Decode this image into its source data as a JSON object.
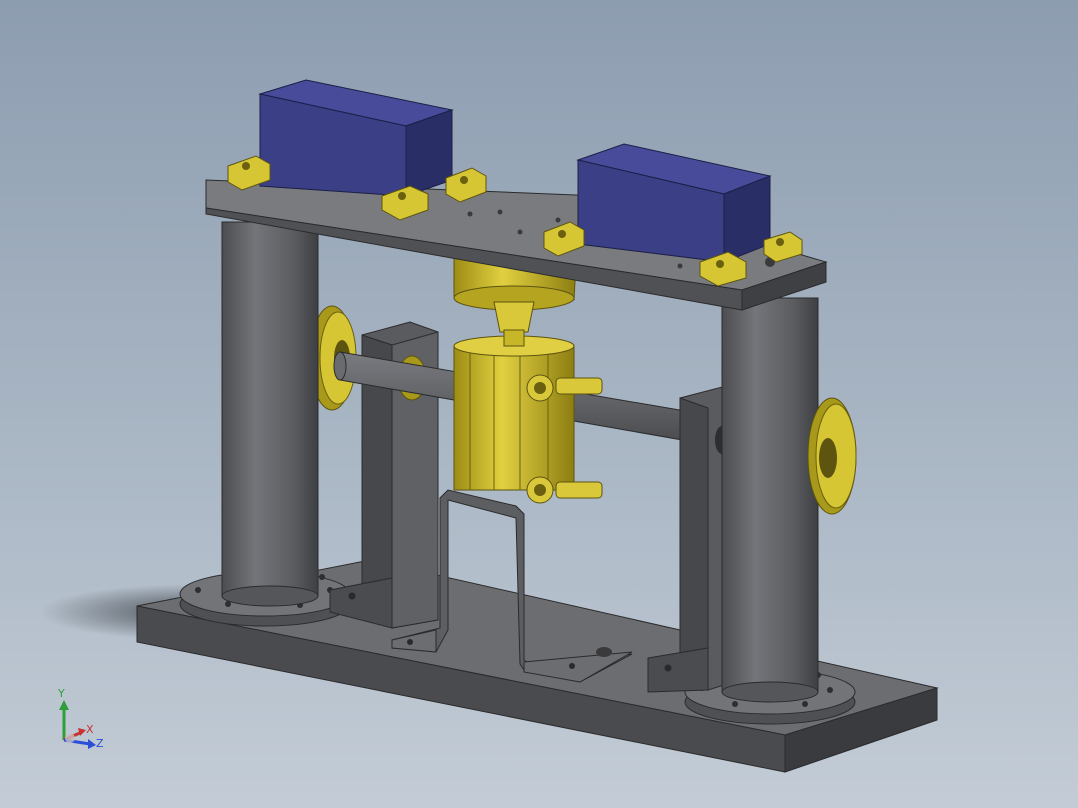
{
  "viewport": {
    "background_top": "#8d9db0",
    "background_bottom": "#c3ccd6"
  },
  "colors": {
    "steel": "#5f6063",
    "steel_dark": "#3c3d40",
    "steel_light": "#7c7d80",
    "brass": "#c8b629",
    "brass_dark": "#7e7010",
    "motor_blue": "#3a3f86",
    "motor_blue_dark": "#23275a"
  },
  "triad": {
    "y_label": "Y",
    "x_label": "X",
    "z_label": "Z",
    "y_color": "#2e9d3a",
    "x_color": "#c83232",
    "z_color": "#2a4fd6"
  }
}
